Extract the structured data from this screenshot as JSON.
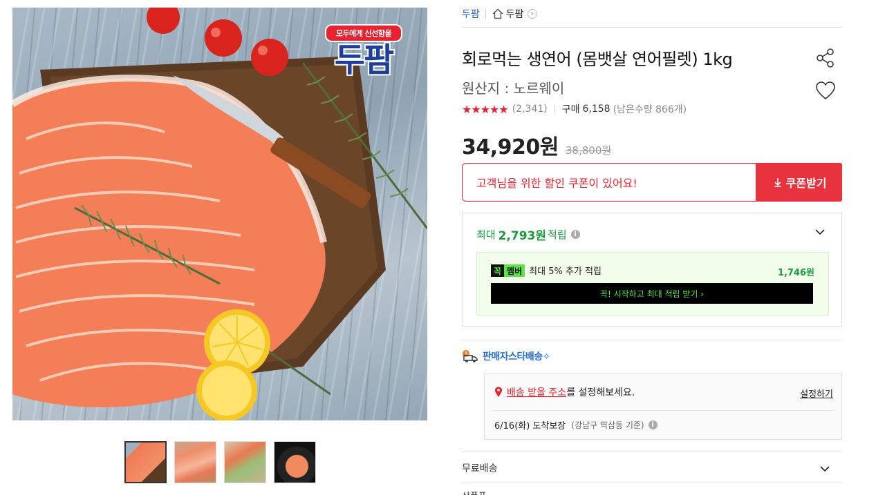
{
  "gallery": {
    "brand_tag": "모두에게 신선함을",
    "brand_logo": "두팜",
    "thumbnails": [
      "salmon-fillet",
      "sliced-salmon",
      "salmon-salad",
      "salmon-plate"
    ]
  },
  "breadcrumb": {
    "seller": "두팜",
    "store": "두팜"
  },
  "product": {
    "title": "회로먹는 생연어 (몸뱃살 연어필렛) 1kg",
    "origin": "원산지 : 노르웨이",
    "stars": "★★★★★",
    "review_count": "(2,341)",
    "purchase_label": "구매",
    "purchase_count": "6,158",
    "stock": "(남은수량 866개)",
    "sale_price": "34,920원",
    "original_price": "38,800원"
  },
  "coupon": {
    "message": "고객님을 위한 할인 쿠폰이 있어요!",
    "button": "쿠폰받기"
  },
  "reward": {
    "prefix": "최대",
    "amount": "2,793원",
    "suffix": "적립",
    "member_badge_1": "꼭",
    "member_badge_2": "멤버",
    "member_text": "최대 5% 추가 적립",
    "member_amount": "1,746원",
    "member_cta": "꼭! 시작하고 최대 적립 받기 ›"
  },
  "delivery": {
    "star_delivery": "판매자스타배송✧",
    "address_link": "배송 받을 주소",
    "address_suffix": "를 설정해보세요.",
    "address_set": "설정하기",
    "arrival": "6/16(화) 도착보장",
    "arrival_base": "(강남구 역삼동 기준)",
    "free_shipping": "무료배송",
    "next_section": "상품푸"
  },
  "colors": {
    "accent_red": "#e8232f",
    "reward_green": "#1a9c3e",
    "delivery_blue": "#2a6fd6"
  }
}
